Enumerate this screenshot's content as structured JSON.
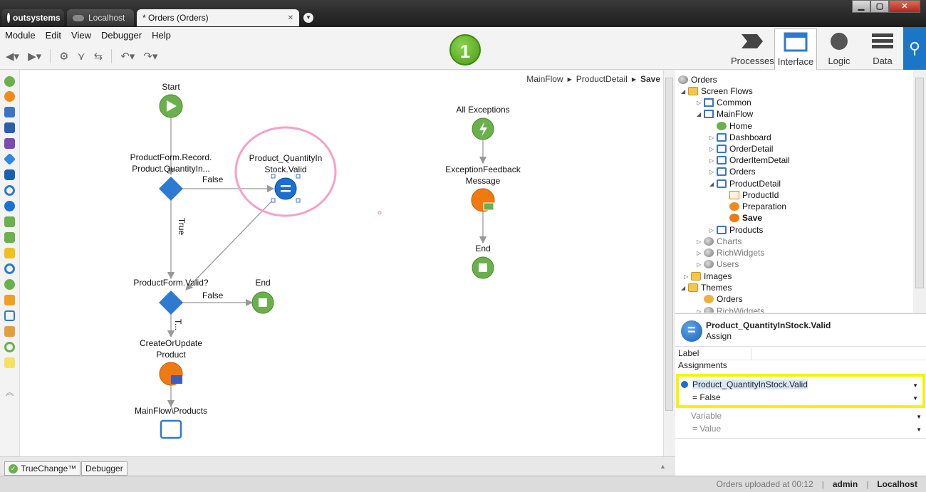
{
  "window": {
    "tabs": [
      {
        "label": "outsystems"
      },
      {
        "label": "Localhost"
      },
      {
        "label": "* Orders (Orders)"
      }
    ],
    "close_glyph": "✕",
    "controls": {
      "minimize": "▁",
      "maximize": "▢",
      "close": "✕"
    }
  },
  "menu": [
    "Module",
    "Edit",
    "View",
    "Debugger",
    "Help"
  ],
  "step_badge": "1",
  "layers": [
    "Processes",
    "Interface",
    "Logic",
    "Data"
  ],
  "active_layer": "Interface",
  "canvas": {
    "breadcrumb": [
      "MainFlow",
      "ProductDetail",
      "Save"
    ],
    "nodes": {
      "start": "Start",
      "if1": [
        "ProductForm.Record.",
        "Product.QuantityIn..."
      ],
      "assign": [
        "Product_QuantityIn",
        "Stock.Valid"
      ],
      "if2": "ProductForm.Valid?",
      "end": "End",
      "create": [
        "CreateOrUpdate",
        "Product"
      ],
      "dest": "MainFlow\\Products",
      "all_exc": "All Exceptions",
      "exc_msg": [
        "ExceptionFeedback",
        "Message"
      ],
      "exc_end": "End"
    },
    "edges": {
      "false1": "False",
      "true1": "True",
      "false2": "False",
      "true2": "T..."
    }
  },
  "tree": {
    "rows": [
      {
        "label": "Orders"
      },
      {
        "label": "Screen Flows"
      },
      {
        "label": "Common"
      },
      {
        "label": "MainFlow"
      },
      {
        "label": "Home"
      },
      {
        "label": "Dashboard"
      },
      {
        "label": "OrderDetail"
      },
      {
        "label": "OrderItemDetail"
      },
      {
        "label": "Orders"
      },
      {
        "label": "ProductDetail"
      },
      {
        "label": "ProductId"
      },
      {
        "label": "Preparation"
      },
      {
        "label": "Save"
      },
      {
        "label": "Products"
      },
      {
        "label": "Charts"
      },
      {
        "label": "RichWidgets"
      },
      {
        "label": "Users"
      },
      {
        "label": "Images"
      },
      {
        "label": "Themes"
      },
      {
        "label": "Orders"
      },
      {
        "label": "RichWidgets"
      }
    ]
  },
  "properties": {
    "name": "Product_QuantityInStock.Valid",
    "type": "Assign",
    "label_title": "Label",
    "assignments_title": "Assignments",
    "assign_variable": "Product_QuantityInStock.Valid",
    "assign_value": "= False",
    "new_variable": "Variable",
    "new_value": "= Value"
  },
  "bottom_tabs": [
    "TrueChange™",
    "Debugger"
  ],
  "status": {
    "message": "Orders uploaded at 00:12",
    "user": "admin",
    "server": "Localhost"
  },
  "colors": {
    "accent_blue": "#1b76c8",
    "highlight": "#f5f500",
    "selection_ring": "#f5a0c8"
  }
}
